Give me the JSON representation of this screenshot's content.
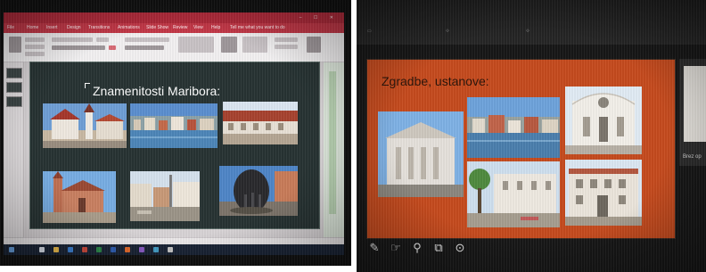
{
  "left_photo": {
    "slide_title": "Znamenitosti Maribora:",
    "menu_items": [
      "File",
      "Home",
      "Insert",
      "Design",
      "Transitions",
      "Animations",
      "Slide Show",
      "Review",
      "View",
      "Help",
      "Tell me what you want to do"
    ]
  },
  "right_photo": {
    "slide_title": "Zgradbe, ustanove:",
    "next_slide_label": "Brez op",
    "tools": [
      "pen-tool",
      "laser-pointer-tool",
      "zoom-tool",
      "see-all-slides-tool",
      "more-options-tool"
    ]
  },
  "colors": {
    "powerpoint_red": "#b02a3a",
    "left_slide_bg": "#273333",
    "right_slide_bg": "#c64b1e"
  }
}
